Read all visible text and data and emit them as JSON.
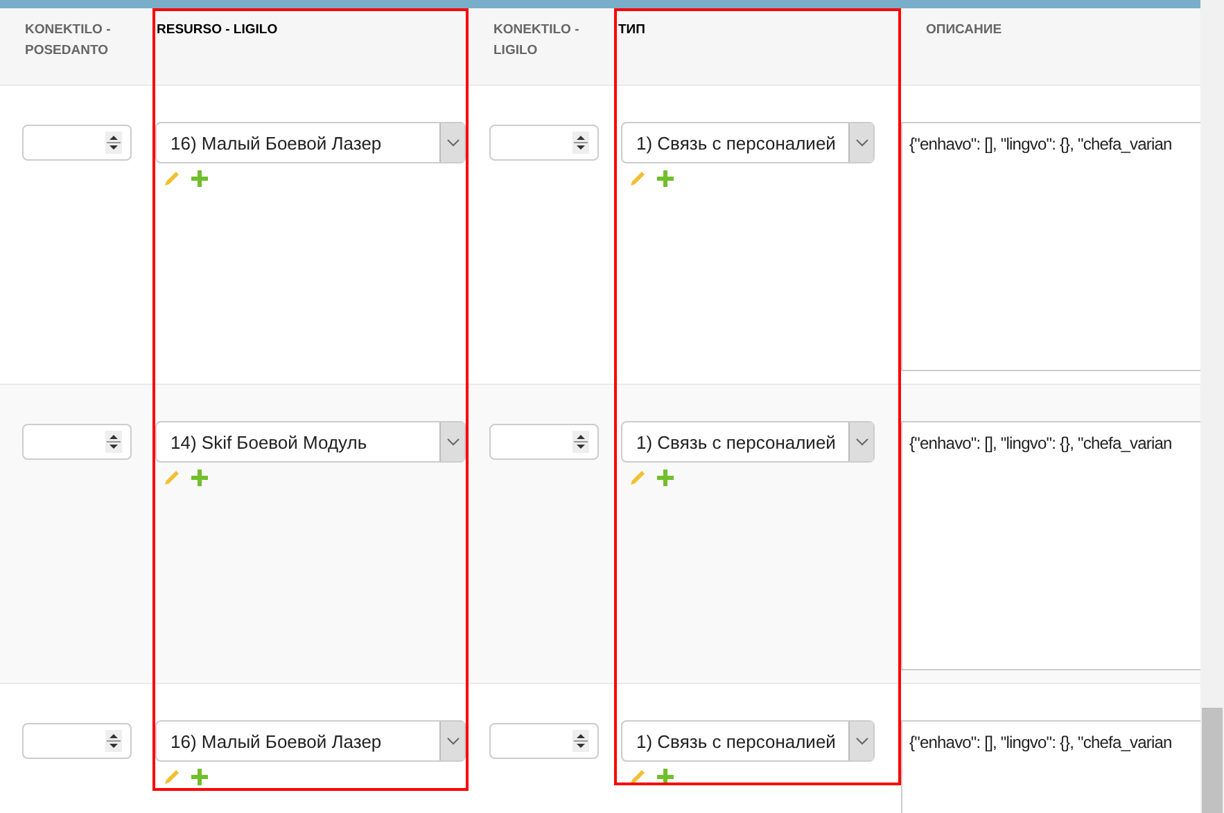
{
  "columns": [
    {
      "label": "KONEKTILO - POSEDANTO",
      "highlighted": false
    },
    {
      "label": "RESURSO - LIGILO",
      "highlighted": true
    },
    {
      "label": "KONEKTILO - LIGILO",
      "highlighted": false
    },
    {
      "label": "ТИП",
      "highlighted": true
    },
    {
      "label": "ОПИСАНИЕ",
      "highlighted": false
    }
  ],
  "rows": [
    {
      "owner_connector": "",
      "resource": "16) Малый Боевой Лазер",
      "link_connector": "",
      "type": "1) Связь с персоналией",
      "description": "{\"enhavo\": [], \"lingvo\": {}, \"chefa_varian"
    },
    {
      "owner_connector": "",
      "resource": "14) Skif Боевой Модуль",
      "link_connector": "",
      "type": "1) Связь с персоналией",
      "description": "{\"enhavo\": [], \"lingvo\": {}, \"chefa_varian"
    },
    {
      "owner_connector": "",
      "resource": "16) Малый Боевой Лазер",
      "link_connector": "",
      "type": "1) Связь с персоналией",
      "description": "{\"enhavo\": [], \"lingvo\": {}, \"chefa_varian"
    }
  ]
}
